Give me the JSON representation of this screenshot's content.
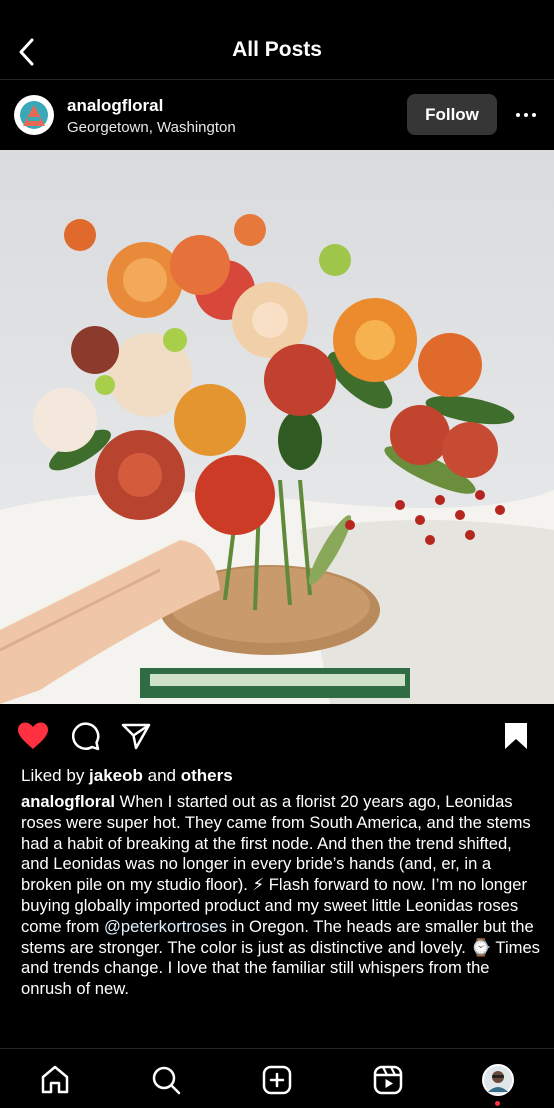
{
  "header": {
    "title": "All Posts"
  },
  "post": {
    "username": "analogfloral",
    "location": "Georgetown, Washington",
    "follow_label": "Follow"
  },
  "likes": {
    "prefix": "Liked by ",
    "user": "jakeob",
    "middle": " and ",
    "others": "others"
  },
  "caption": {
    "author": "analogfloral",
    "text_part1": " When I started out as a florist 20 years ago, Leonidas roses were super hot. They came from South America, and the stems had a habit of breaking at the first node. And then the trend shifted, and Leonidas was no longer in every bride’s hands (and, er, in a broken pile on my studio floor). ⚡ Flash forward to now. I’m no longer buying globally imported product and my sweet little Leonidas roses come from ",
    "mention": "@peterkortroses",
    "text_part2": " in Oregon. The heads are smaller but the stems are stronger. The color is just as distinctive and lovely. ⌚ Times and trends change. I love that the familiar still whispers from the onrush of new."
  },
  "icons": {
    "back": "chevron-left-icon",
    "more": "more-horizontal-icon",
    "like": "heart-icon",
    "comment": "comment-icon",
    "share": "send-icon",
    "save": "bookmark-icon",
    "nav": [
      "home-icon",
      "search-icon",
      "create-icon",
      "reels-icon",
      "profile-avatar"
    ]
  },
  "colors": {
    "like": "#ff3040",
    "notification_dot": "#ff3040"
  }
}
